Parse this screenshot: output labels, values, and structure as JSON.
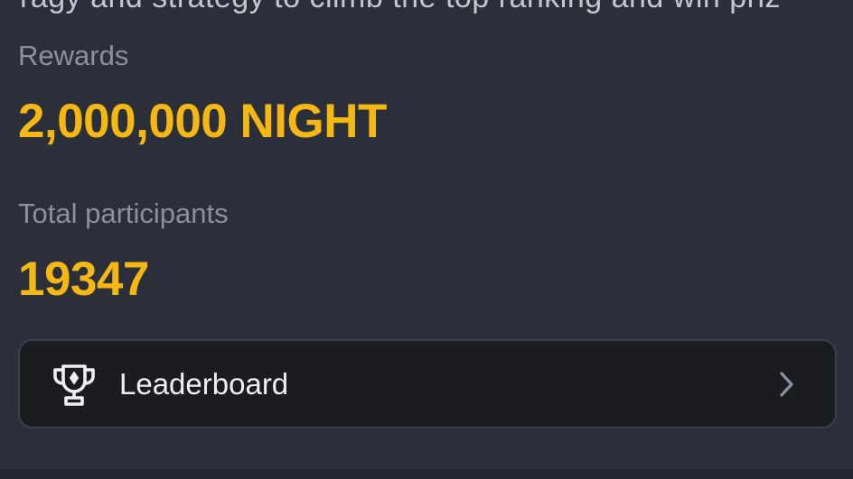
{
  "colors": {
    "background": "#2a2f3a",
    "accent": "#f5b813",
    "muted": "#8b919c",
    "card": "#1b1c20"
  },
  "top_partial_text": "ragy and strategy to climb the top ranking and win priz",
  "rewards": {
    "label": "Rewards",
    "value": "2,000,000 NIGHT"
  },
  "participants": {
    "label": "Total participants",
    "value": "19347"
  },
  "leaderboard": {
    "label": "Leaderboard",
    "icon": "trophy-icon",
    "trailing_icon": "chevron-right-icon"
  }
}
